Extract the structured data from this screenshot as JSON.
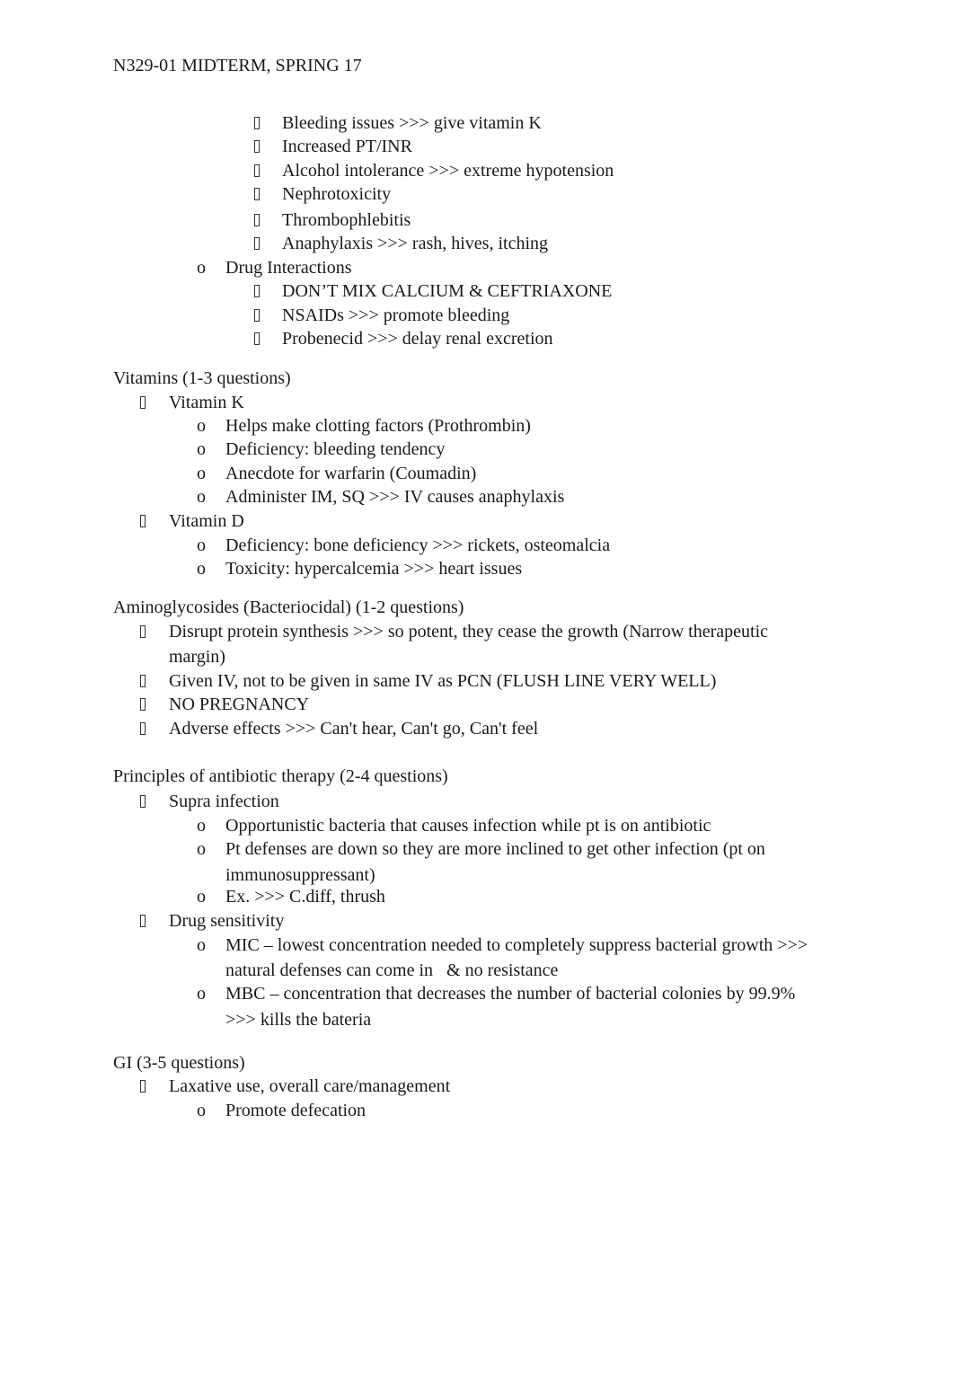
{
  "header": "N329-01 MIDTERM, SPRING 17",
  "icons": {
    "square_bullet": "missing-glyph-square-bullet",
    "circle_bullet": "o"
  },
  "cephalosporins_adverse": [
    "Bleeding issues >>> give vitamin K",
    "Increased PT/INR",
    "Alcohol intolerance >>> extreme hypotension",
    "Nephrotoxicity",
    "Thrombophlebitis",
    "Anaphylaxis >>> rash, hives, itching"
  ],
  "drug_interactions": {
    "label": "Drug Interactions",
    "items": [
      "DON’T MIX CALCIUM & CEFTRIAXONE",
      "NSAIDs >>> promote bleeding",
      "Probenecid >>> delay renal excretion"
    ]
  },
  "vitamins": {
    "heading": "Vitamins (1-3 questions)",
    "vitamin_k": {
      "label": "Vitamin K",
      "items": [
        "Helps make clotting factors (Prothrombin)",
        "Deficiency: bleeding tendency",
        "Anecdote for warfarin (Coumadin)",
        "Administer IM, SQ >>> IV causes anaphylaxis"
      ]
    },
    "vitamin_d": {
      "label": "Vitamin D",
      "items": [
        "Deficiency: bone deficiency >>> rickets, osteomalcia",
        "Toxicity: hypercalcemia >>> heart issues"
      ]
    }
  },
  "aminoglycosides": {
    "heading": "Aminoglycosides (Bacteriocidal) (1-2 questions)",
    "items": [
      [
        "Disrupt protein synthesis >>> so potent, they cease the growth (Narrow therapeutic",
        "margin)"
      ],
      [
        "Given IV, not to be given in same IV as PCN (FLUSH LINE VERY WELL)"
      ],
      [
        "NO PREGNANCY"
      ],
      [
        "Adverse effects >>> Can't hear, Can't go, Can't feel"
      ]
    ]
  },
  "antibiotic_therapy": {
    "heading": "Principles of antibiotic therapy (2-4 questions)",
    "supra_infection": {
      "label": "Supra infection",
      "items": [
        [
          "Opportunistic bacteria that causes infection while pt is on antibiotic"
        ],
        [
          "Pt defenses are down so they are more inclined to get other infection (pt on",
          "immunosuppressant)"
        ],
        [
          "Ex. >>> C.diff, thrush"
        ]
      ]
    },
    "drug_sensitivity": {
      "label": "Drug sensitivity",
      "items": [
        [
          "MIC – lowest concentration needed to completely suppress bacterial growth >>>",
          "natural defenses can come in   & no resistance"
        ],
        [
          "MBC – concentration that decreases the number of bacterial colonies by 99.9%",
          ">>> kills the bateria"
        ]
      ]
    }
  },
  "gi": {
    "heading": "GI (3-5 questions)",
    "laxative": {
      "label": "Laxative use, overall care/management",
      "items": [
        "Promote defecation"
      ]
    }
  }
}
